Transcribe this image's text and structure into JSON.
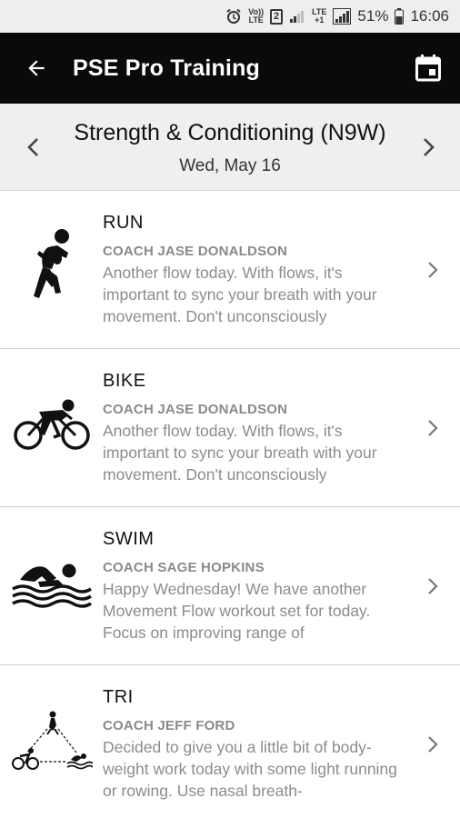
{
  "status_bar": {
    "vol_label_top": "Vo))",
    "vol_label_bottom": "LTE",
    "sim_label": "2",
    "network_label_top": "LTE",
    "network_label_bottom": "+1",
    "battery": "51%",
    "time": "16:06"
  },
  "app_bar": {
    "title": "PSE Pro Training",
    "back_icon": "arrow-back-icon",
    "calendar_icon": "calendar-icon"
  },
  "date_header": {
    "session_title": "Strength & Conditioning (N9W)",
    "date": "Wed, May 16"
  },
  "workouts": [
    {
      "type": "RUN",
      "coach": "COACH JASE DONALDSON",
      "description": "Another flow today. With flows, it's important to sync your breath with your movement. Don't unconsciously",
      "icon": "runner-icon"
    },
    {
      "type": "BIKE",
      "coach": "COACH JASE DONALDSON",
      "description": "Another flow today. With flows, it's important to sync your breath with your movement. Don't unconsciously",
      "icon": "cyclist-icon"
    },
    {
      "type": "SWIM",
      "coach": "COACH SAGE HOPKINS",
      "description": "Happy Wednesday! We have another Movement Flow workout set for today. Focus on improving range of",
      "icon": "swimmer-icon"
    },
    {
      "type": "TRI",
      "coach": "COACH JEFF FORD",
      "description": "Decided to give you a little bit of body-weight work today with some light running or rowing. Use nasal breath-",
      "icon": "triathlon-icon"
    }
  ],
  "colors": {
    "app_bar": "#0a0a0a",
    "header_bg": "#efefef",
    "muted_text": "#8c8c8c"
  }
}
